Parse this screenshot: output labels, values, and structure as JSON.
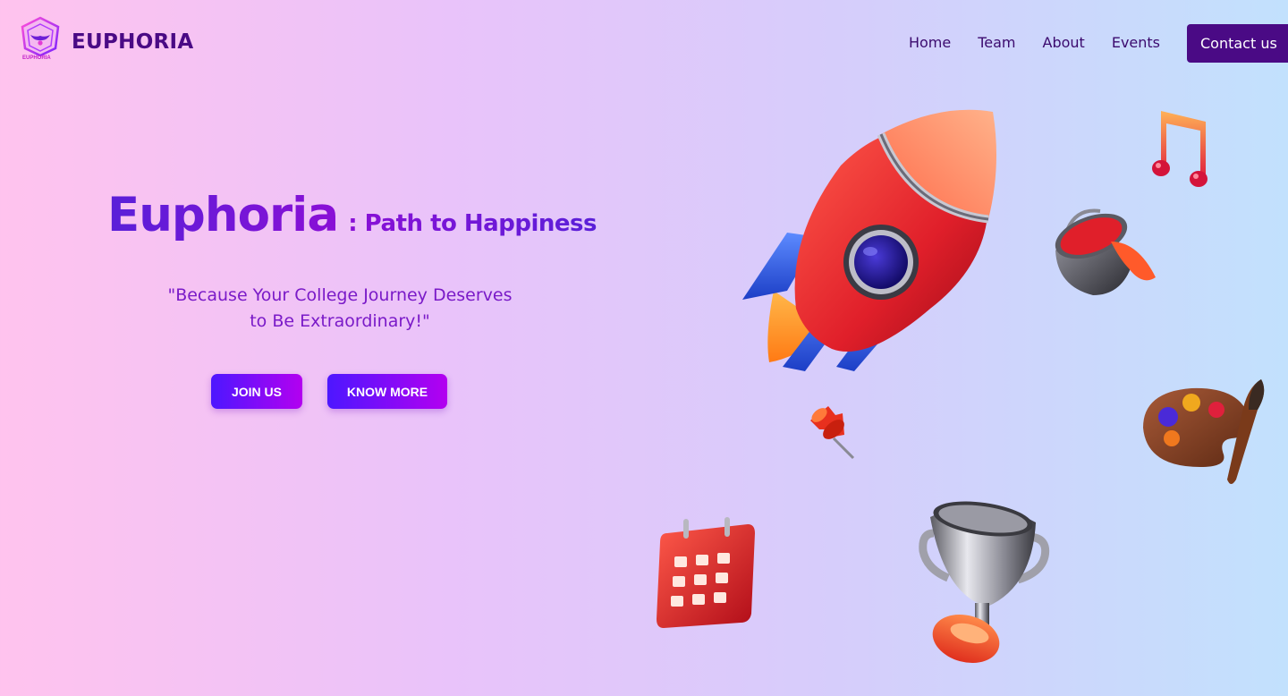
{
  "header": {
    "brand": "EUPHORIA",
    "logo_caption": "EUPHORIA",
    "nav": [
      {
        "label": "Home"
      },
      {
        "label": "Team"
      },
      {
        "label": "About"
      },
      {
        "label": "Events"
      }
    ],
    "contact_label": "Contact us"
  },
  "hero": {
    "title": "Euphoria",
    "subtitle": ": Path to Happiness",
    "quote_line1": "\"Because Your College Journey Deserves",
    "quote_line2": "to Be Extraordinary!\"",
    "join_label": "JOIN US",
    "know_label": "KNOW MORE"
  },
  "illustrations": [
    "rocket-icon",
    "music-note-icon",
    "paint-bucket-icon",
    "push-pin-icon",
    "palette-icon",
    "calendar-icon",
    "trophy-icon"
  ],
  "colors": {
    "brand": "#4a0a85",
    "accent_start": "#4d17ff",
    "accent_end": "#b300f0",
    "title": "#5a1fd8",
    "quote": "#7a1ac8"
  }
}
